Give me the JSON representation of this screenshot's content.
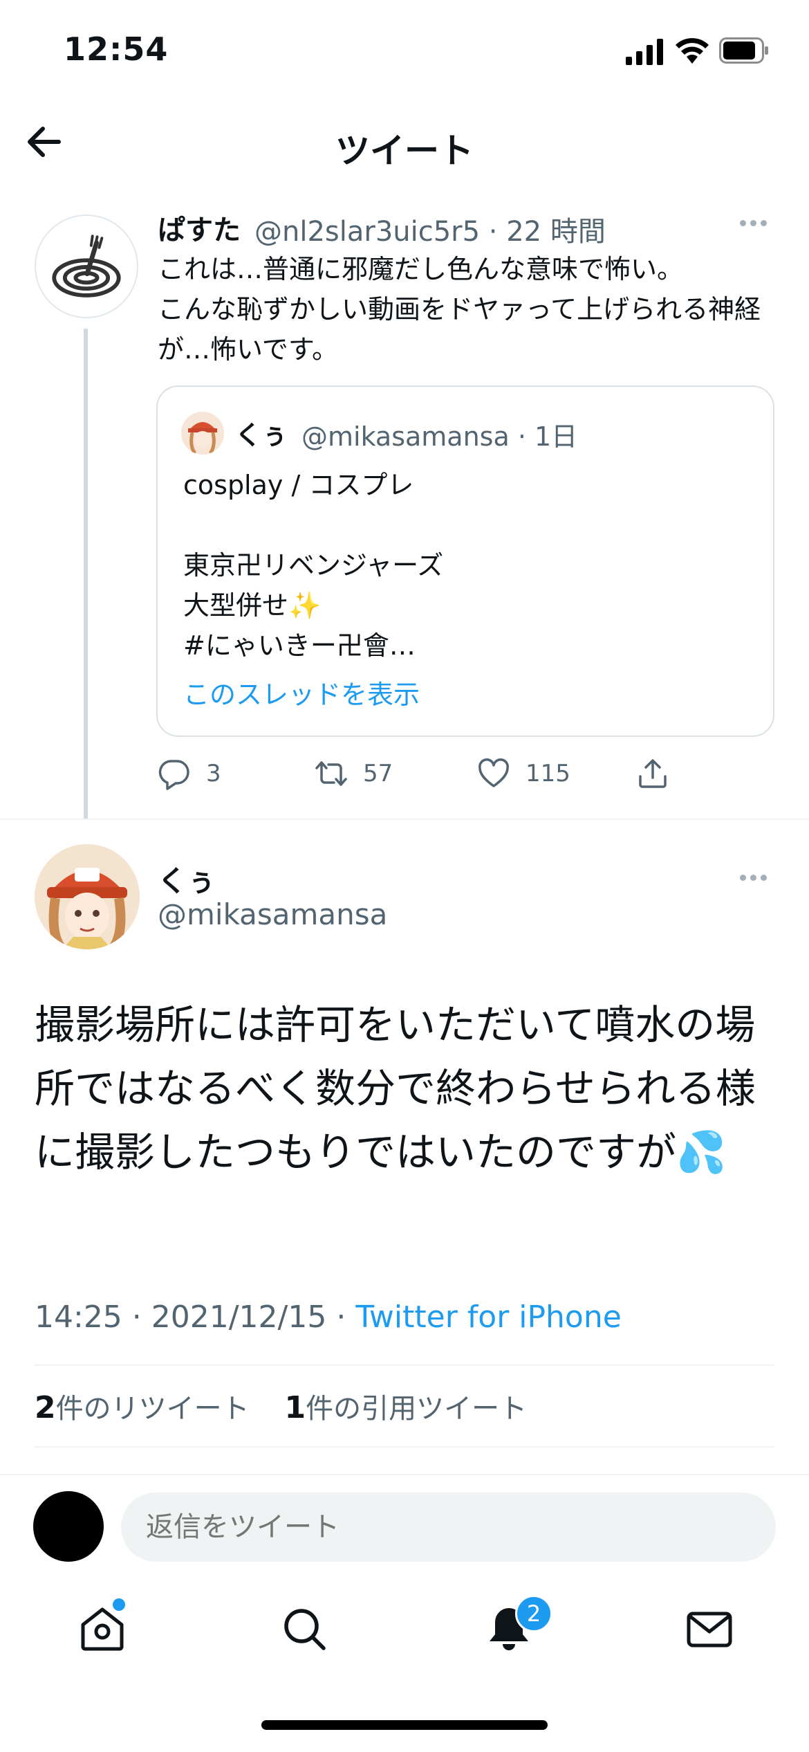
{
  "status_bar": {
    "time": "12:54"
  },
  "header": {
    "title": "ツイート"
  },
  "parent_tweet": {
    "name": "ぱすた",
    "meta": "@nl2slar3uic5r5 · 22 時間",
    "text": "これは…普通に邪魔だし色んな意味で怖い。\nこんな恥ずかしい動画をドヤァって上げられる神経が…怖いです。",
    "quote": {
      "name": "くぅ",
      "meta": "@mikasamansa · 1日",
      "text": "cosplay / コスプレ\n\n東京卍リベンジャーズ\n大型併せ✨\n #にゃいきー卍會…",
      "thread_link": "このスレッドを表示"
    },
    "actions": {
      "replies": "3",
      "retweets": "57",
      "likes": "115"
    }
  },
  "main_tweet": {
    "name": "くぅ",
    "handle": "@mikasamansa",
    "text": "撮影場所には許可をいただいて噴水の場所ではなるべく数分で終わらせられる様に撮影したつもりではいたのですが💦",
    "time": "14:25 · 2021/12/15 · ",
    "source": "Twitter for iPhone",
    "stats": {
      "retweet_count": "2",
      "retweet_label": "件のリツイート",
      "quote_count": "1",
      "quote_label": "件の引用ツイート"
    }
  },
  "composer": {
    "placeholder": "返信をツイート"
  },
  "tab_bar": {
    "items": [
      "home-icon",
      "search-icon",
      "notifications-icon",
      "messages-icon"
    ],
    "notification_badge": "2"
  },
  "colors": {
    "accent": "#1d9bf0",
    "text_secondary": "#536471",
    "divider": "#eff3f4"
  }
}
